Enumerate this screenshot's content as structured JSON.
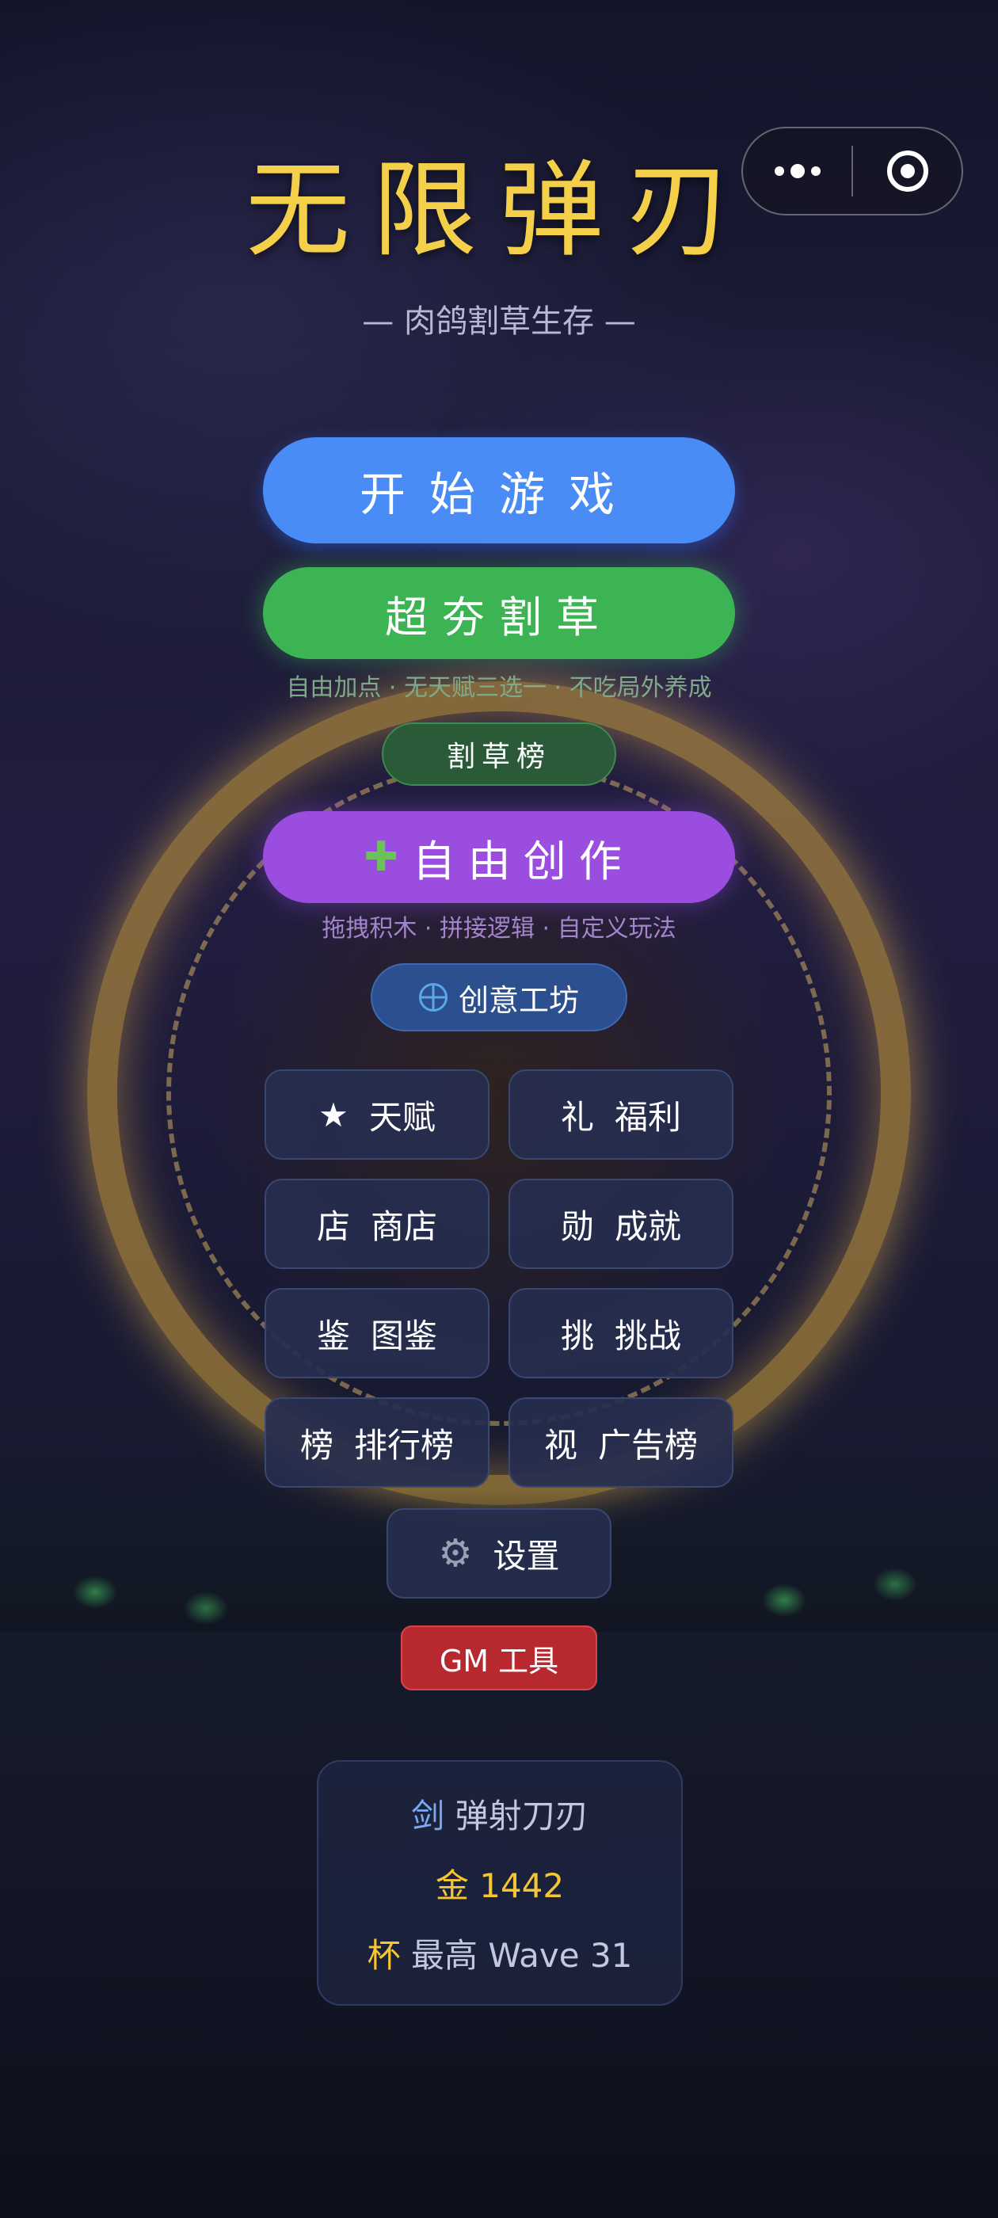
{
  "capsule": {
    "menu_icon": "more-dots-icon",
    "close_icon": "target-icon"
  },
  "header": {
    "title": "无限弹刃",
    "subtitle": "— 肉鸽割草生存 —"
  },
  "main": {
    "start_label": "开始游戏",
    "mow_label": "超夯割草",
    "mow_hint": "自由加点 · 无天赋三选一 · 不吃局外养成",
    "board_label": "割草榜",
    "create_icon": "puzzle-icon",
    "create_label": "自由创作",
    "create_hint": "拖拽积木 · 拼接逻辑 · 自定义玩法",
    "workshop_icon": "globe-icon",
    "workshop_label": "创意工坊"
  },
  "menu": {
    "items": [
      {
        "icon": "★",
        "label": "天赋"
      },
      {
        "icon": "礼",
        "label": "福利"
      },
      {
        "icon": "店",
        "label": "商店"
      },
      {
        "icon": "勋",
        "label": "成就"
      },
      {
        "icon": "鉴",
        "label": "图鉴"
      },
      {
        "icon": "挑",
        "label": "挑战"
      },
      {
        "icon": "榜",
        "label": "排行榜"
      },
      {
        "icon": "视",
        "label": "广告榜"
      }
    ],
    "settings_icon": "⚙",
    "settings_label": "设置",
    "gm_label": "GM 工具"
  },
  "stats": {
    "weapon_icon": "剑",
    "weapon_name": "弹射刀刃",
    "gold_icon": "金",
    "gold_value": "1442",
    "best_icon": "杯",
    "best_text": "最高 Wave 31"
  },
  "colors": {
    "title": "#f4cf4a",
    "start": "#4a8cf5",
    "mow": "#3db454",
    "create": "#9b4de0",
    "gm": "#b7292e"
  }
}
